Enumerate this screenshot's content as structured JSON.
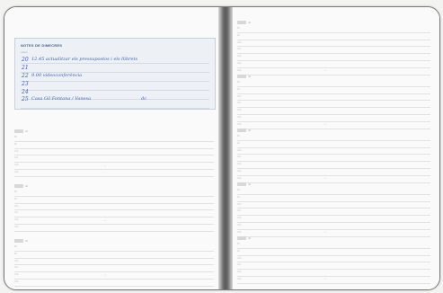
{
  "notes": {
    "title": "NOTES DE DIMECRES",
    "sub": "notes",
    "entries": [
      {
        "num": "20",
        "text": "12.45  actualitzar els pressupostos i els llibrets"
      },
      {
        "num": "21",
        "text": ""
      },
      {
        "num": "22",
        "text": "9.00  videoconferència"
      },
      {
        "num": "23",
        "text": ""
      },
      {
        "num": "24",
        "text": ""
      },
      {
        "num": "25",
        "text": "Casa Gil Fontana  /  Vanesa"
      }
    ],
    "extra": "dc"
  },
  "block": {
    "tag_label": "dil",
    "row_labels": [
      "8h",
      "9h",
      "10h",
      "11h",
      "12h",
      "13h",
      "14h"
    ],
    "mark": "• •"
  }
}
